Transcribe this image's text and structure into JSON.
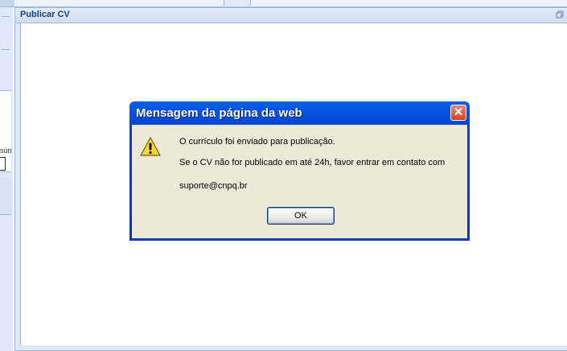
{
  "panel": {
    "title": "Publicar CV",
    "tool_icon": "restore-icon"
  },
  "background": {
    "left_label": "sün"
  },
  "dialog": {
    "title": "Mensagem da página da web",
    "close_label": "✕",
    "icon": "warning-icon",
    "line1": "O currículo foi enviado para publicação.",
    "line2": "Se o CV não for publicado em até 24h, favor entrar em contato com",
    "line3": "suporte@cnpq.br",
    "ok_label": "OK"
  }
}
